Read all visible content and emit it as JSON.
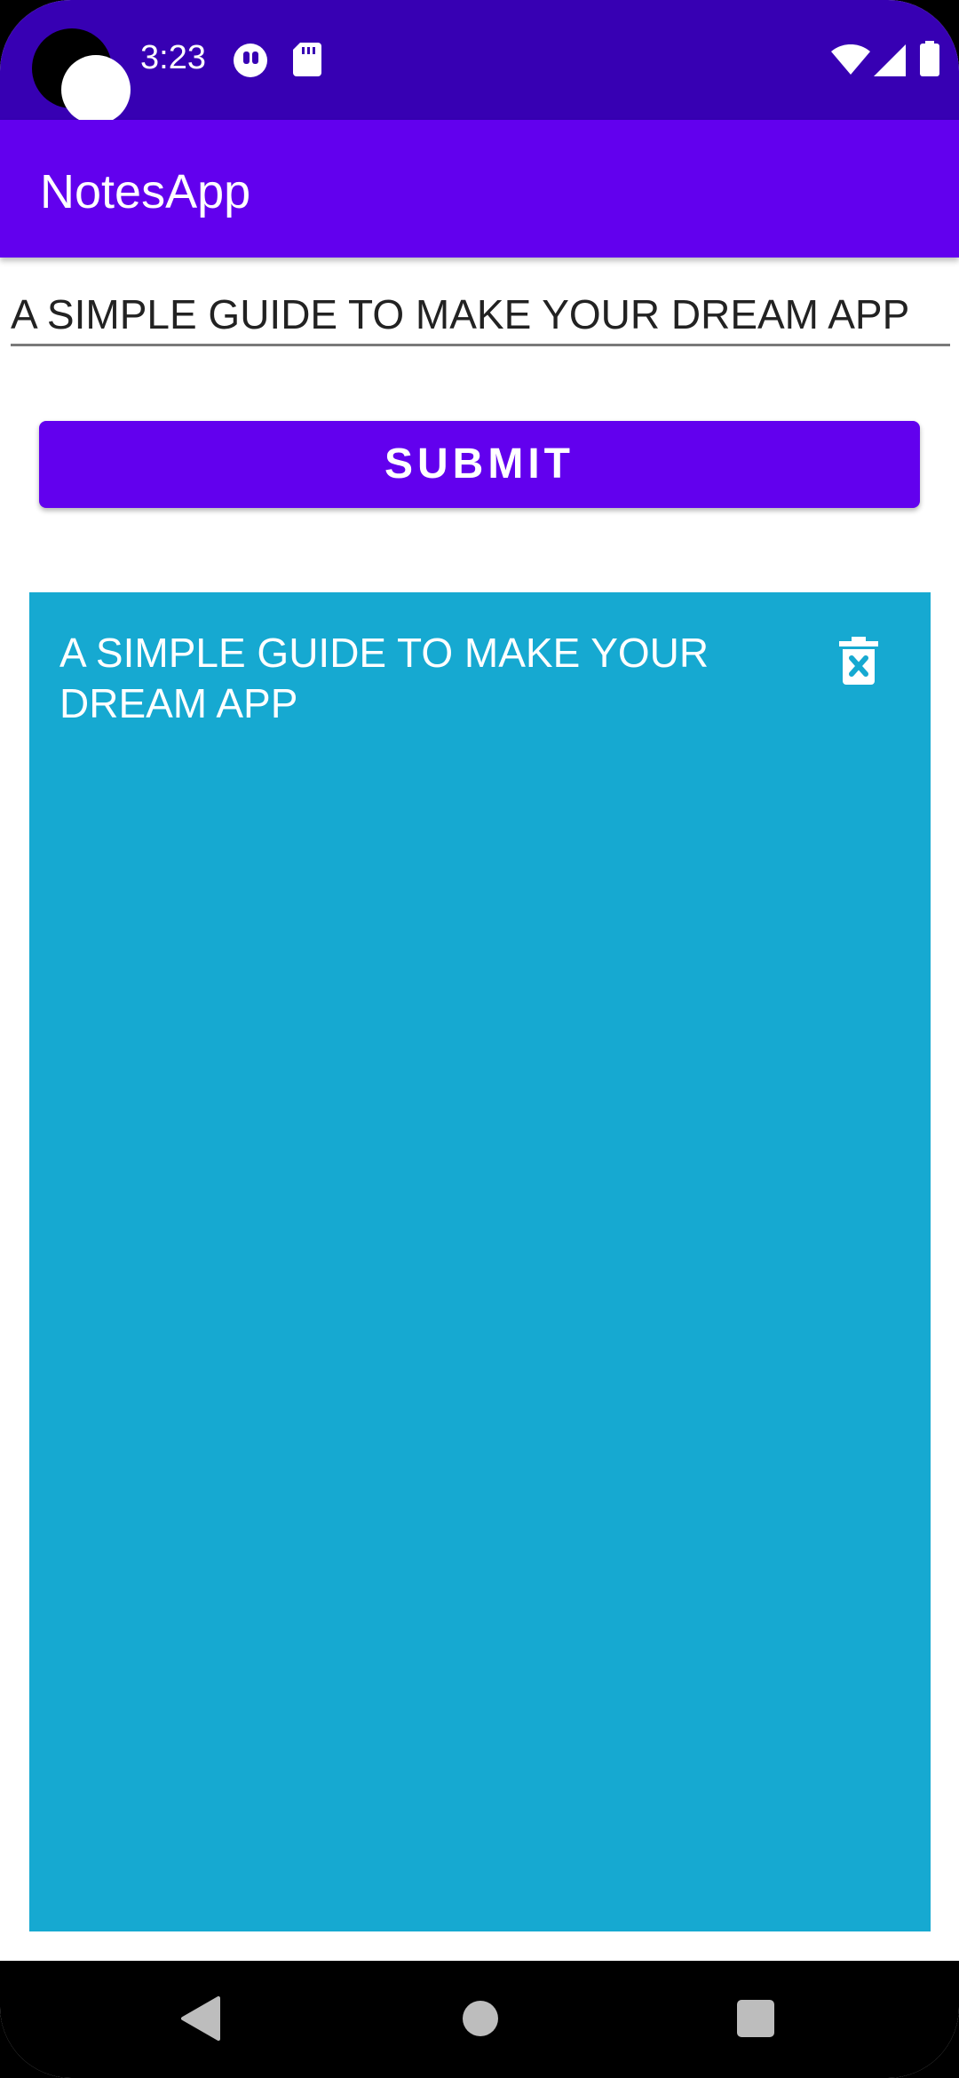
{
  "status_bar": {
    "time": "3:23",
    "icons": [
      "record-icon",
      "sd-card-icon",
      "wifi-icon",
      "signal-icon",
      "battery-icon"
    ],
    "background": "#3700B3"
  },
  "app_bar": {
    "title": "NotesApp",
    "background": "#6200EE"
  },
  "note_input": {
    "value": "A SIMPLE GUIDE TO MAKE YOUR DREAM APP",
    "placeholder": ""
  },
  "submit_button": {
    "label": "SUBMIT",
    "background": "#6200EE"
  },
  "notes": [
    {
      "text": "A SIMPLE GUIDE TO MAKE YOUR DREAM APP",
      "background": "#16A9D1",
      "icon": "delete-icon"
    }
  ],
  "nav_bar": {
    "buttons": [
      "back-icon",
      "home-icon",
      "recents-icon"
    ]
  }
}
